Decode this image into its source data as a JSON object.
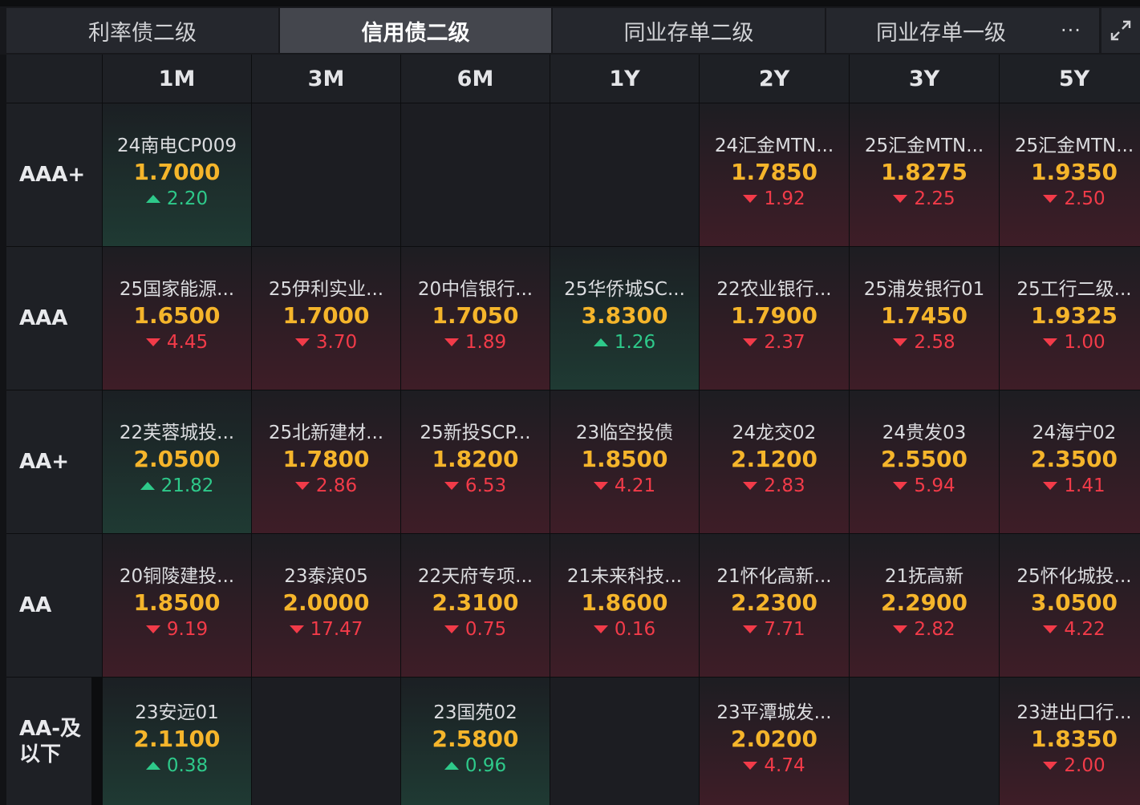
{
  "tabs": [
    {
      "label": "利率债二级",
      "active": false
    },
    {
      "label": "信用债二级",
      "active": true
    },
    {
      "label": "同业存单二级",
      "active": false
    },
    {
      "label": "同业存单一级",
      "active": false
    }
  ],
  "more_label": "···",
  "columns": [
    "1M",
    "3M",
    "6M",
    "1Y",
    "2Y",
    "3Y",
    "5Y"
  ],
  "rows": [
    {
      "label": "AAA+",
      "cells": [
        {
          "name": "24南电CP009",
          "yield": "1.7000",
          "change": "2.20",
          "dir": "up"
        },
        null,
        null,
        null,
        {
          "name": "24汇金MTN...",
          "yield": "1.7850",
          "change": "1.92",
          "dir": "down"
        },
        {
          "name": "25汇金MTN...",
          "yield": "1.8275",
          "change": "2.25",
          "dir": "down"
        },
        {
          "name": "25汇金MTN...",
          "yield": "1.9350",
          "change": "2.50",
          "dir": "down"
        }
      ]
    },
    {
      "label": "AAA",
      "cells": [
        {
          "name": "25国家能源...",
          "yield": "1.6500",
          "change": "4.45",
          "dir": "down"
        },
        {
          "name": "25伊利实业...",
          "yield": "1.7000",
          "change": "3.70",
          "dir": "down"
        },
        {
          "name": "20中信银行...",
          "yield": "1.7050",
          "change": "1.89",
          "dir": "down"
        },
        {
          "name": "25华侨城SC...",
          "yield": "3.8300",
          "change": "1.26",
          "dir": "up"
        },
        {
          "name": "22农业银行...",
          "yield": "1.7900",
          "change": "2.37",
          "dir": "down"
        },
        {
          "name": "25浦发银行01",
          "yield": "1.7450",
          "change": "2.58",
          "dir": "down"
        },
        {
          "name": "25工行二级...",
          "yield": "1.9325",
          "change": "1.00",
          "dir": "down"
        }
      ]
    },
    {
      "label": "AA+",
      "cells": [
        {
          "name": "22芙蓉城投...",
          "yield": "2.0500",
          "change": "21.82",
          "dir": "up"
        },
        {
          "name": "25北新建材...",
          "yield": "1.7800",
          "change": "2.86",
          "dir": "down"
        },
        {
          "name": "25新投SCP...",
          "yield": "1.8200",
          "change": "6.53",
          "dir": "down"
        },
        {
          "name": "23临空投债",
          "yield": "1.8500",
          "change": "4.21",
          "dir": "down"
        },
        {
          "name": "24龙交02",
          "yield": "2.1200",
          "change": "2.83",
          "dir": "down"
        },
        {
          "name": "24贵发03",
          "yield": "2.5500",
          "change": "5.94",
          "dir": "down"
        },
        {
          "name": "24海宁02",
          "yield": "2.3500",
          "change": "1.41",
          "dir": "down"
        }
      ]
    },
    {
      "label": "AA",
      "cells": [
        {
          "name": "20铜陵建投...",
          "yield": "1.8500",
          "change": "9.19",
          "dir": "down"
        },
        {
          "name": "23泰滨05",
          "yield": "2.0000",
          "change": "17.47",
          "dir": "down"
        },
        {
          "name": "22天府专项...",
          "yield": "2.3100",
          "change": "0.75",
          "dir": "down"
        },
        {
          "name": "21未来科技...",
          "yield": "1.8600",
          "change": "0.16",
          "dir": "down"
        },
        {
          "name": "21怀化高新...",
          "yield": "2.2300",
          "change": "7.71",
          "dir": "down"
        },
        {
          "name": "21抚高新",
          "yield": "2.2900",
          "change": "2.82",
          "dir": "down"
        },
        {
          "name": "25怀化城投...",
          "yield": "3.0500",
          "change": "4.22",
          "dir": "down"
        }
      ]
    },
    {
      "label": "AA-及以下",
      "cells": [
        {
          "name": "23安远01",
          "yield": "2.1100",
          "change": "0.38",
          "dir": "up"
        },
        null,
        {
          "name": "23国苑02",
          "yield": "2.5800",
          "change": "0.96",
          "dir": "up"
        },
        null,
        {
          "name": "23平潭城发...",
          "yield": "2.0200",
          "change": "4.74",
          "dir": "down"
        },
        null,
        {
          "name": "23进出口行...",
          "yield": "1.8350",
          "change": "2.00",
          "dir": "down"
        }
      ]
    }
  ],
  "colors": {
    "up": "#2ec98a",
    "down": "#f23b49",
    "yield": "#f5b52b"
  }
}
